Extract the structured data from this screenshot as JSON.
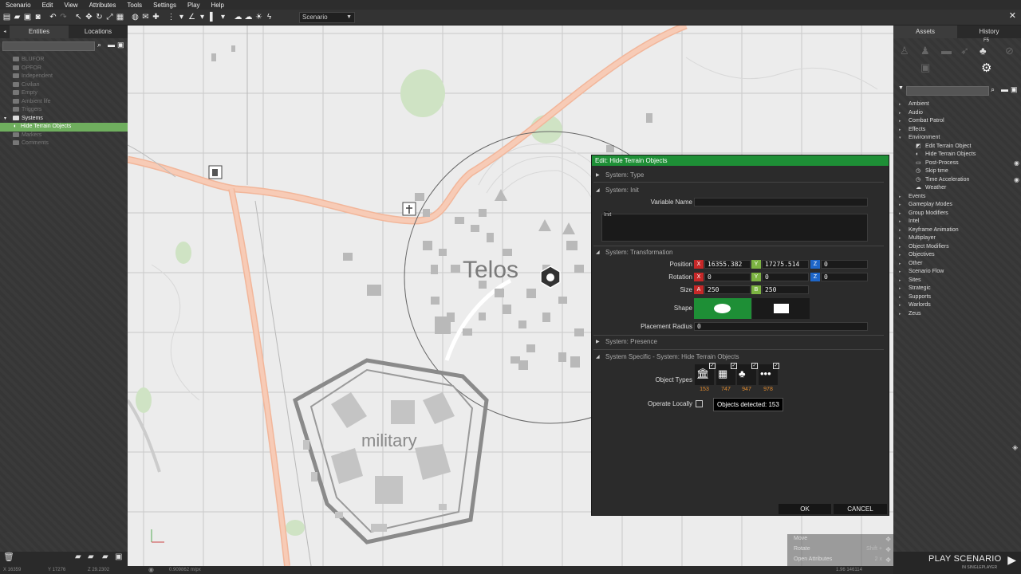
{
  "menu": [
    "Scenario",
    "Edit",
    "View",
    "Attributes",
    "Tools",
    "Settings",
    "Play",
    "Help"
  ],
  "toolbar": {
    "scenario_select": "Scenario"
  },
  "left_panel": {
    "tabs": [
      "Entities",
      "Locations"
    ],
    "tree": [
      {
        "label": "BLUFOR",
        "active": false
      },
      {
        "label": "OPFOR",
        "active": false
      },
      {
        "label": "Independent",
        "active": false
      },
      {
        "label": "Civilian",
        "active": false
      },
      {
        "label": "Empty",
        "active": false
      },
      {
        "label": "Ambient life",
        "active": false
      },
      {
        "label": "Triggers",
        "active": false
      },
      {
        "label": "Systems",
        "active": true
      },
      {
        "label": "Hide Terrain Objects",
        "active": true,
        "selected": true
      },
      {
        "label": "Markers",
        "active": false
      },
      {
        "label": "Comments",
        "active": false
      }
    ]
  },
  "status": {
    "x": "16359",
    "y": "17276",
    "z": "29.2302",
    "scale": "0.909862 m/px",
    "fps": "1.96 146114"
  },
  "map": {
    "town": "Telos",
    "military_label": "military"
  },
  "right_panel": {
    "tabs": [
      "Assets",
      "History"
    ],
    "hotkey": "F5",
    "list": [
      {
        "label": "Ambient",
        "level": 0
      },
      {
        "label": "Audio",
        "level": 0
      },
      {
        "label": "Combat Patrol",
        "level": 0
      },
      {
        "label": "Effects",
        "level": 0
      },
      {
        "label": "Environment",
        "level": 0,
        "open": true
      },
      {
        "label": "Edit Terrain Object",
        "level": 1
      },
      {
        "label": "Hide Terrain Objects",
        "level": 1
      },
      {
        "label": "Post-Process",
        "level": 1,
        "eye": true
      },
      {
        "label": "Skip time",
        "level": 1
      },
      {
        "label": "Time Acceleration",
        "level": 1,
        "eye": true
      },
      {
        "label": "Weather",
        "level": 1
      },
      {
        "label": "Events",
        "level": 0
      },
      {
        "label": "Gameplay Modes",
        "level": 0
      },
      {
        "label": "Group Modifiers",
        "level": 0
      },
      {
        "label": "Intel",
        "level": 0
      },
      {
        "label": "Keyframe Animation",
        "level": 0
      },
      {
        "label": "Multiplayer",
        "level": 0
      },
      {
        "label": "Object Modifiers",
        "level": 0
      },
      {
        "label": "Objectives",
        "level": 0
      },
      {
        "label": "Other",
        "level": 0
      },
      {
        "label": "Scenario Flow",
        "level": 0
      },
      {
        "label": "Sites",
        "level": 0
      },
      {
        "label": "Strategic",
        "level": 0
      },
      {
        "label": "Supports",
        "level": 0
      },
      {
        "label": "Warlords",
        "level": 0
      },
      {
        "label": "Zeus",
        "level": 0
      }
    ]
  },
  "hints": [
    {
      "label": "Move",
      "key": ""
    },
    {
      "label": "Rotate",
      "key": "Shift +"
    },
    {
      "label": "Open Attributes",
      "key": "2 x"
    }
  ],
  "play": {
    "label": "PLAY SCENARIO",
    "sub": "IN SINGLEPLAYER"
  },
  "dialog": {
    "title": "Edit: Hide Terrain Objects",
    "sections": {
      "type": "System: Type",
      "init": "System: Init",
      "transformation": "System: Transformation",
      "presence": "System: Presence",
      "specific": "System Specific - System: Hide Terrain Objects"
    },
    "variable_name_label": "Variable Name",
    "variable_name_value": "",
    "init_label": "Init",
    "position_label": "Position",
    "position": {
      "x": "16355.382",
      "y": "17275.514",
      "z": "0"
    },
    "rotation_label": "Rotation",
    "rotation": {
      "x": "0",
      "y": "0",
      "z": "0"
    },
    "size_label": "Size",
    "size": {
      "a": "250",
      "b": "250"
    },
    "shape_label": "Shape",
    "placement_radius_label": "Placement Radius",
    "placement_radius": "0",
    "object_types_label": "Object Types",
    "object_counts": [
      "153",
      "747",
      "947",
      "978"
    ],
    "operate_locally_label": "Operate Locally",
    "tooltip": "Objects detected: 153",
    "ok": "OK",
    "cancel": "CANCEL",
    "axis_letters": {
      "x": "X",
      "y": "Y",
      "z": "Z",
      "a": "A",
      "b": "B"
    }
  },
  "colors": {
    "accent_green": "#1e8f36",
    "selected_row": "#6fae5e",
    "count_orange": "#e08a2e"
  }
}
